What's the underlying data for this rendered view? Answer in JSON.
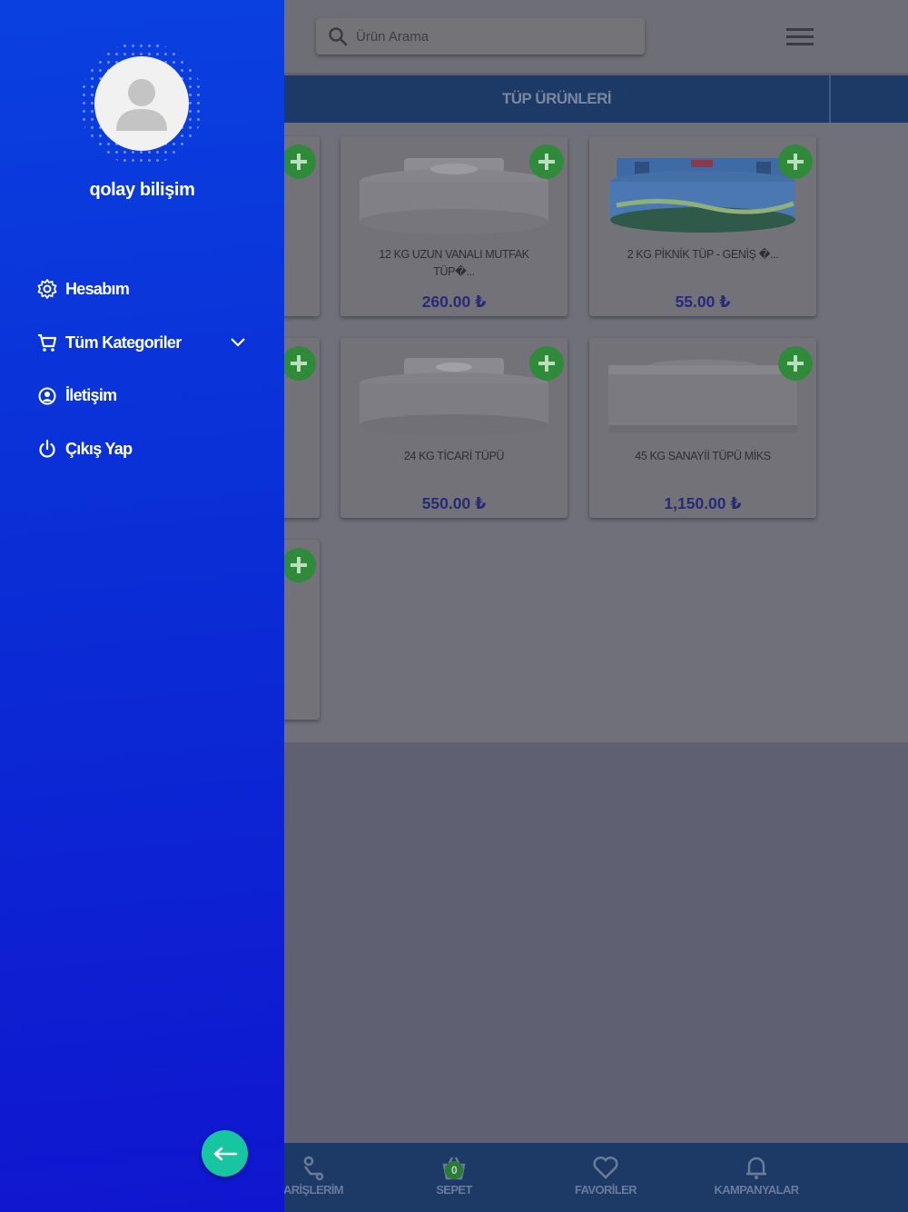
{
  "search": {
    "placeholder": "Ürün Arama"
  },
  "category_tab": {
    "label": "TÜP ÜRÜNLERİ"
  },
  "products": [
    {
      "name": "12 KG UZUN VANALI MUTFAK TÜP�...",
      "price": "260.00 ₺"
    },
    {
      "name": "2 KG PİKNİK TÜP - GENİŞ �...",
      "price": "55.00 ₺"
    },
    {
      "name": "24 KG TİCARİ TÜPÜ",
      "price": "550.00 ₺"
    },
    {
      "name": "45 KG SANAYİİ TÜPÜ MİKS",
      "price": "1,150.00 ₺"
    }
  ],
  "bottom_nav": {
    "orders_label": "ARİŞLERİM",
    "cart_label": "SEPET",
    "cart_count": "0",
    "favorites_label": "FAVORİLER",
    "campaigns_label": "KAMPANYALAR"
  },
  "sidebar": {
    "username": "qolay bilişim",
    "items": [
      {
        "label": "Hesabım",
        "icon": "gear-icon"
      },
      {
        "label": "Tüm Kategoriler",
        "icon": "cart-icon"
      },
      {
        "label": "İletişim",
        "icon": "contact-icon"
      },
      {
        "label": "Çıkış Yap",
        "icon": "power-icon"
      }
    ]
  },
  "colors": {
    "sidebar_start": "#0a40e0",
    "sidebar_end": "#1016cf",
    "fab": "#17c5a0",
    "add_button": "#2f8a3a",
    "price": "#282a78",
    "nav_bar": "#1d3a66"
  }
}
